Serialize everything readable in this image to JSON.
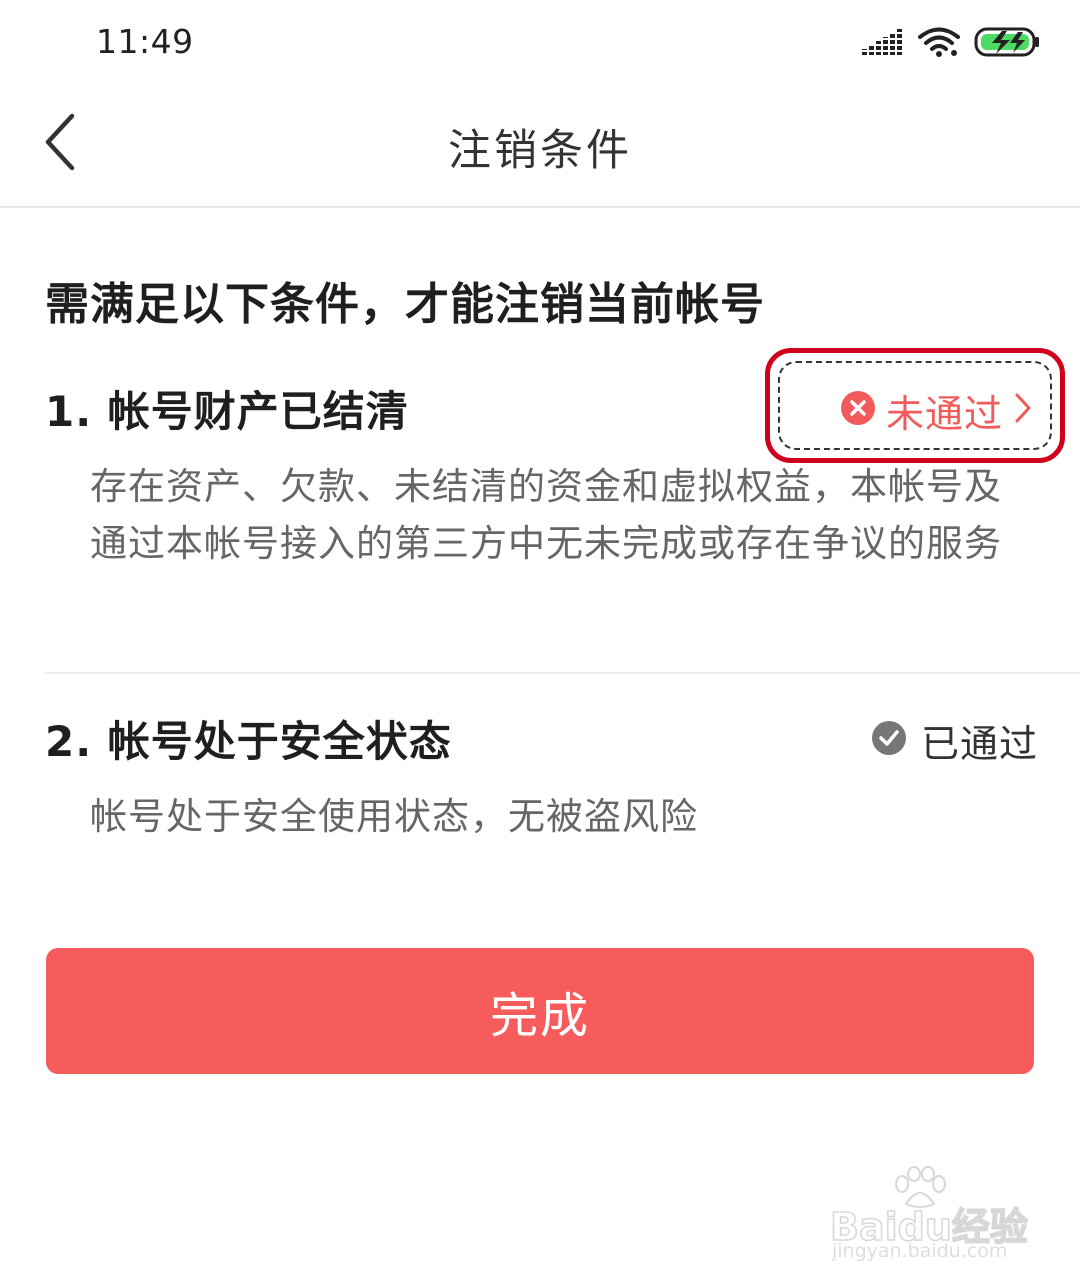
{
  "status_bar": {
    "time": "11:49"
  },
  "nav": {
    "title": "注销条件"
  },
  "heading": "需满足以下条件，才能注销当前帐号",
  "conditions": [
    {
      "title": "1. 帐号财产已结清",
      "description": "存在资产、欠款、未结清的资金和虚拟权益，本帐号及通过本帐号接入的第三方中无未完成或存在争议的服务",
      "status": "未通过",
      "status_type": "fail",
      "status_color": "#f25b5b"
    },
    {
      "title": "2. 帐号处于安全状态",
      "description": "帐号处于安全使用状态，无被盗风险",
      "status": "已通过",
      "status_type": "pass",
      "status_color": "#666666"
    }
  ],
  "done_button": {
    "label": "完成",
    "color": "#f75c5c"
  },
  "highlight": {
    "color": "#d0021b"
  },
  "watermark": {
    "main": "Baidu经验",
    "sub": "jingyan.baidu.com"
  }
}
